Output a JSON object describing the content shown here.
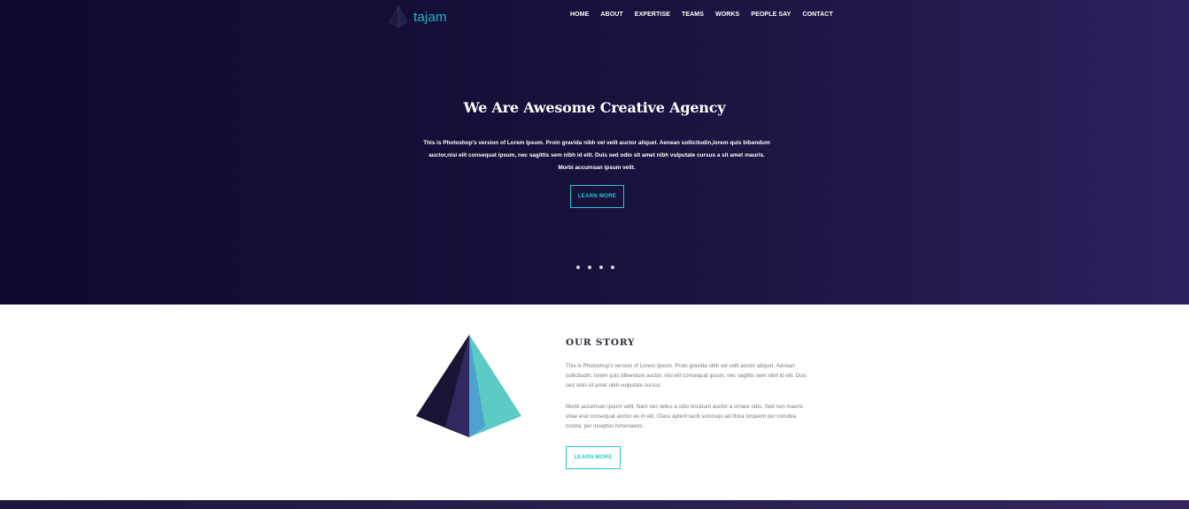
{
  "brand": {
    "name": "tajam",
    "accent": "#2bc5cf"
  },
  "nav": [
    "HOME",
    "ABOUT",
    "EXPERTISE",
    "TEAMS",
    "WORKS",
    "PEOPLE SAY",
    "CONTACT"
  ],
  "hero": {
    "title": "We Are Awesome Creative Agency",
    "description": "This is Photoshop's version  of Lorem Ipsum. Proin gravida nibh vel velit auctor aliquet. Aenean sollicitudin,lorem quis bibendum auctor,nisi elit consequat ipsum, nec sagittis sem nibh id elit. Duis sed odio sit amet nibh vulputate cursus a sit amet mauris. Morbi accumsan ipsum velit.",
    "button": "LEARN MORE",
    "slides": 4,
    "gradient": [
      "#0e0a2e",
      "#2f1f5e"
    ]
  },
  "story": {
    "title": "OUR STORY",
    "paragraph1": "This is Photoshop's version  of Lorem Ipsum. Proin gravida nibh vel velit auctor aliquet. Aenean sollicitudin, lorem quis bibendum auctor, nisi elit consequat ipsum, nec sagittis sem nibh id elit. Duis sed odio sit amet nibh vulputate cursus",
    "paragraph2": "Morbi accumsan ipsum velit. Nam nec tellus a odio tincidunt auctor a ornare odio. Sed non  mauris vitae erat consequat auctor eu in elit. Class aptent taciti sociosqu ad litora torquent per conubia nostra, per inceptos himenaeos.",
    "button": "LEARN MORE",
    "illustration": "pyramid-icon",
    "pyramid_colors": [
      "#181434",
      "#30285f",
      "#4ba3cf",
      "#5ccbc4"
    ]
  }
}
